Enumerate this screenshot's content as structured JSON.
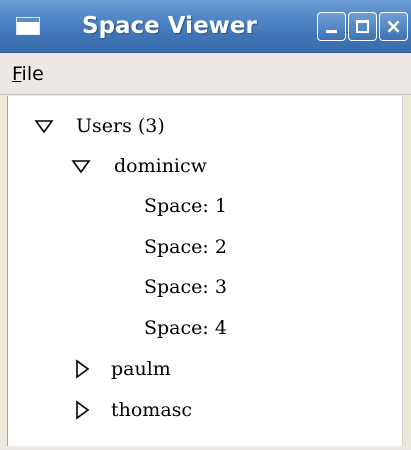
{
  "window": {
    "title": "Space Viewer",
    "controls": {
      "minimize": "minimize",
      "maximize": "maximize",
      "close": "×"
    }
  },
  "menubar": {
    "file": {
      "mnemonic": "F",
      "rest": "ile"
    }
  },
  "tree": {
    "users": {
      "label": "Users (3)",
      "expanded": true
    },
    "dominicw": {
      "label": "dominicw",
      "expanded": true
    },
    "spaces": [
      {
        "label": "Space: 1"
      },
      {
        "label": "Space: 2"
      },
      {
        "label": "Space: 3"
      },
      {
        "label": "Space: 4"
      }
    ],
    "paulm": {
      "label": "paulm",
      "expanded": false
    },
    "thomasc": {
      "label": "thomasc",
      "expanded": false
    }
  }
}
